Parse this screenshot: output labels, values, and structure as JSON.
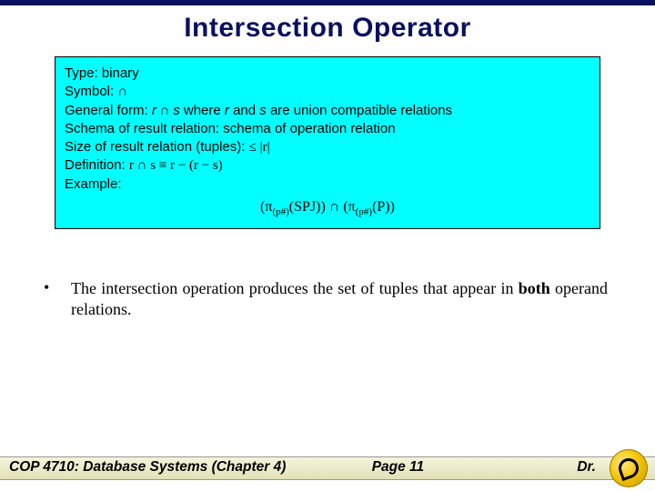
{
  "title": "Intersection Operator",
  "box": {
    "type_label": "Type: ",
    "type_value": "binary",
    "symbol_label": "Symbol: ",
    "symbol_value": "∩",
    "general_form_label": "General form:  ",
    "general_form_r": "r",
    "general_form_op": " ∩ ",
    "general_form_s": "s",
    "general_form_rest_1": " where ",
    "general_form_rest_2": " and ",
    "general_form_rest_3": " are union compatible relations",
    "schema_line": "Schema of result relation: schema of operation relation",
    "size_label": "Size of result relation (tuples):  ",
    "size_expr": "≤ |r|",
    "def_label": "Definition:  ",
    "def_expr": "r ∩ s ≡ r − (r − s)",
    "example_label": "Example:",
    "example_expr_left": "(π",
    "example_sub": "(p#)",
    "example_spj": "(SPJ)) ",
    "example_cap": "∩",
    "example_right_open": " (π",
    "example_p": "(P))"
  },
  "bullet": {
    "mark": "•",
    "text_1": "The intersection operation produces the set of tuples that appear in ",
    "text_bold": "both",
    "text_2": " operand relations."
  },
  "footer": {
    "course": "COP 4710: Database Systems  (Chapter 4)",
    "page": "Page 11",
    "author": "Dr."
  }
}
